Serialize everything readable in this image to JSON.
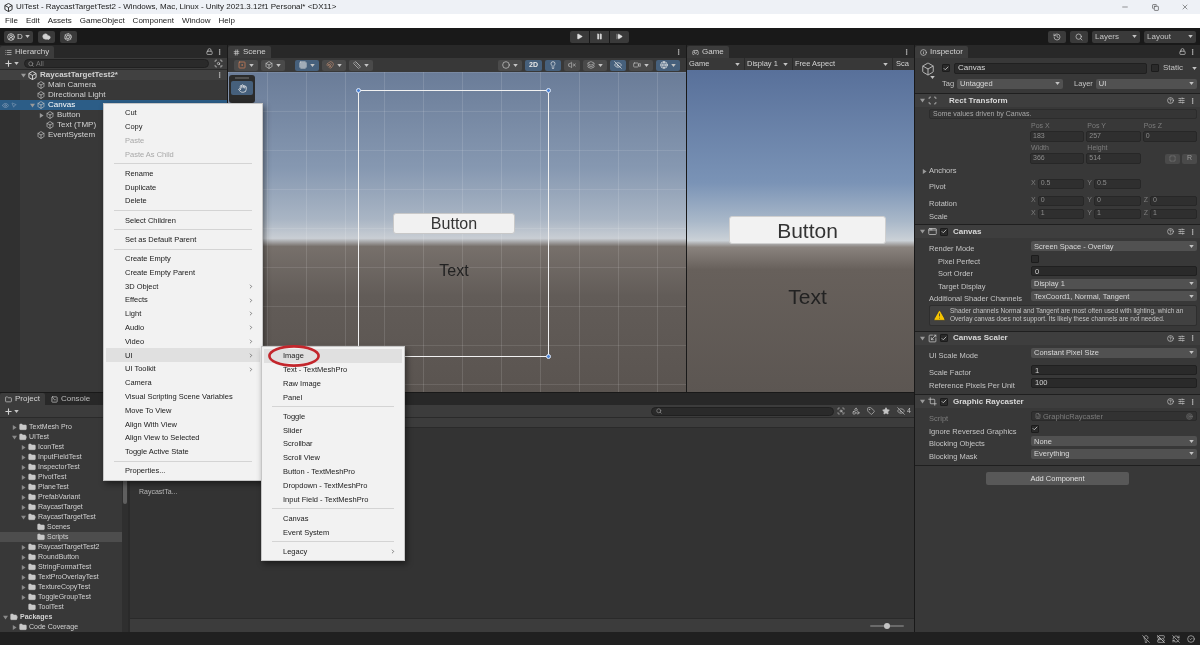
{
  "window": {
    "title": "UITest - RaycastTargetTest2 - Windows, Mac, Linux - Unity 2021.3.12f1 Personal* <DX11>"
  },
  "menu_bar": [
    "File",
    "Edit",
    "Assets",
    "GameObject",
    "Component",
    "Window",
    "Help"
  ],
  "toolbar": {
    "account": "D",
    "layers": "Layers",
    "layout": "Layout"
  },
  "hierarchy": {
    "tab": "Hierarchy",
    "search_placeholder": "All",
    "scene": {
      "label": "RaycastTargetTest2*",
      "expanded": true,
      "children": [
        {
          "label": "Main Camera",
          "selected": false
        },
        {
          "label": "Directional Light",
          "selected": false
        },
        {
          "label": "Canvas",
          "selected": true,
          "expanded": true,
          "children": [
            {
              "label": "Button",
              "selected": false,
              "expanded": false
            },
            {
              "label": "Text (TMP)",
              "selected": false
            }
          ]
        },
        {
          "label": "EventSystem",
          "selected": false
        }
      ]
    }
  },
  "scene_view": {
    "tab": "Scene",
    "toolbar_groups": [
      [
        {
          "kind": "draw_mode",
          "on": false,
          "dropdown": true
        },
        {
          "kind": "shading_cube",
          "on": false,
          "dropdown": true
        }
      ],
      [
        {
          "kind": "grid",
          "on": true,
          "dropdown": true
        },
        {
          "kind": "snap",
          "on": false,
          "dropdown": true
        },
        {
          "kind": "increment",
          "on": false,
          "dropdown": true
        }
      ],
      [
        {
          "kind": "render_sphere",
          "on": false,
          "dropdown": true
        },
        {
          "kind": "text",
          "label": "2D",
          "on": true,
          "dropdown": false
        },
        {
          "kind": "lighting",
          "on": true,
          "dropdown": false
        },
        {
          "kind": "audio",
          "on": false,
          "dropdown": false
        },
        {
          "kind": "effects",
          "on": false,
          "dropdown": true
        },
        {
          "kind": "visibility",
          "on": true,
          "dropdown": false
        },
        {
          "kind": "camera",
          "on": false,
          "dropdown": true
        },
        {
          "kind": "gizmos",
          "on": true,
          "dropdown": true
        }
      ]
    ],
    "tools": [
      {
        "kind": "hand",
        "selected": true
      }
    ],
    "button_label": "Button",
    "text_label": "Text"
  },
  "game_view": {
    "tab": "Game",
    "controls": [
      {
        "kind": "dropdown",
        "label": "Game"
      },
      {
        "kind": "dropdown",
        "label": "Display 1"
      },
      {
        "kind": "dropdown",
        "label": "Free Aspect"
      },
      {
        "kind": "label",
        "label": "Sca"
      }
    ],
    "button_label": "Button",
    "text_label": "Text"
  },
  "context_menu": {
    "groups": [
      [
        {
          "label": "Cut",
          "disabled": false,
          "submenu": false,
          "highlighted": false
        },
        {
          "label": "Copy",
          "disabled": false,
          "submenu": false,
          "highlighted": false
        },
        {
          "label": "Paste",
          "disabled": true,
          "submenu": false,
          "highlighted": false
        },
        {
          "label": "Paste As Child",
          "disabled": true,
          "submenu": false,
          "highlighted": false
        }
      ],
      [
        {
          "label": "Rename",
          "disabled": false,
          "submenu": false,
          "highlighted": false
        },
        {
          "label": "Duplicate",
          "disabled": false,
          "submenu": false,
          "highlighted": false
        },
        {
          "label": "Delete",
          "disabled": false,
          "submenu": false,
          "highlighted": false
        }
      ],
      [
        {
          "label": "Select Children",
          "disabled": false,
          "submenu": false,
          "highlighted": false
        }
      ],
      [
        {
          "label": "Set as Default Parent",
          "disabled": false,
          "submenu": false,
          "highlighted": false
        }
      ],
      [
        {
          "label": "Create Empty",
          "disabled": false,
          "submenu": false,
          "highlighted": false
        },
        {
          "label": "Create Empty Parent",
          "disabled": false,
          "submenu": false,
          "highlighted": false
        },
        {
          "label": "3D Object",
          "disabled": false,
          "submenu": true,
          "highlighted": false
        },
        {
          "label": "Effects",
          "disabled": false,
          "submenu": true,
          "highlighted": false
        },
        {
          "label": "Light",
          "disabled": false,
          "submenu": true,
          "highlighted": false
        },
        {
          "label": "Audio",
          "disabled": false,
          "submenu": true,
          "highlighted": false
        },
        {
          "label": "Video",
          "disabled": false,
          "submenu": true,
          "highlighted": false
        },
        {
          "label": "UI",
          "disabled": false,
          "submenu": true,
          "highlighted": true
        },
        {
          "label": "UI Toolkit",
          "disabled": false,
          "submenu": true,
          "highlighted": false
        },
        {
          "label": "Camera",
          "disabled": false,
          "submenu": false,
          "highlighted": false
        },
        {
          "label": "Visual Scripting Scene Variables",
          "disabled": false,
          "submenu": false,
          "highlighted": false
        },
        {
          "label": "Move To View",
          "disabled": false,
          "submenu": false,
          "highlighted": false
        },
        {
          "label": "Align With View",
          "disabled": false,
          "submenu": false,
          "highlighted": false
        },
        {
          "label": "Align View to Selected",
          "disabled": false,
          "submenu": false,
          "highlighted": false
        },
        {
          "label": "Toggle Active State",
          "disabled": false,
          "submenu": false,
          "highlighted": false
        }
      ],
      [
        {
          "label": "Properties...",
          "disabled": false,
          "submenu": false,
          "highlighted": false
        }
      ]
    ]
  },
  "ui_submenu": {
    "groups": [
      [
        {
          "label": "Image",
          "submenu": false,
          "highlighted": true,
          "circled": true
        },
        {
          "label": "Text - TextMeshPro",
          "submenu": false,
          "highlighted": false,
          "circled": false
        },
        {
          "label": "Raw Image",
          "submenu": false,
          "highlighted": false,
          "circled": false
        },
        {
          "label": "Panel",
          "submenu": false,
          "highlighted": false,
          "circled": false
        }
      ],
      [
        {
          "label": "Toggle",
          "submenu": false,
          "highlighted": false,
          "circled": false
        },
        {
          "label": "Slider",
          "submenu": false,
          "highlighted": false,
          "circled": false
        },
        {
          "label": "Scrollbar",
          "submenu": false,
          "highlighted": false,
          "circled": false
        },
        {
          "label": "Scroll View",
          "submenu": false,
          "highlighted": false,
          "circled": false
        },
        {
          "label": "Button - TextMeshPro",
          "submenu": false,
          "highlighted": false,
          "circled": false
        },
        {
          "label": "Dropdown - TextMeshPro",
          "submenu": false,
          "highlighted": false,
          "circled": false
        },
        {
          "label": "Input Field - TextMeshPro",
          "submenu": false,
          "highlighted": false,
          "circled": false
        }
      ],
      [
        {
          "label": "Canvas",
          "submenu": false,
          "highlighted": false,
          "circled": false
        },
        {
          "label": "Event System",
          "submenu": false,
          "highlighted": false,
          "circled": false
        }
      ],
      [
        {
          "label": "Legacy",
          "submenu": true,
          "highlighted": false,
          "circled": false
        }
      ]
    ]
  },
  "project": {
    "tabs": [
      {
        "label": "Project",
        "selected": true
      },
      {
        "label": "Console",
        "selected": false
      }
    ],
    "tree_top": [
      {
        "label": "TextMesh Pro",
        "expanded": false,
        "selected": false
      },
      {
        "label": "UITest",
        "expanded": true,
        "selected": false,
        "children": [
          {
            "label": "IconTest",
            "expanded": false,
            "selected": false
          },
          {
            "label": "InputFieldTest",
            "expanded": false,
            "selected": false
          },
          {
            "label": "InspectorTest",
            "expanded": false,
            "selected": false
          },
          {
            "label": "PivotTest",
            "expanded": false,
            "selected": false
          },
          {
            "label": "PlaneTest",
            "expanded": false,
            "selected": false
          },
          {
            "label": "PrefabVariant",
            "expanded": false,
            "selected": false
          },
          {
            "label": "RaycastTarget",
            "expanded": false,
            "selected": false
          },
          {
            "label": "RaycastTargetTest",
            "expanded": true,
            "selected": false,
            "children": [
              {
                "label": "Scenes",
                "selected": false
              },
              {
                "label": "Scripts",
                "selected": true
              }
            ]
          },
          {
            "label": "RaycastTargetTest2",
            "expanded": false,
            "selected": false
          },
          {
            "label": "RoundButton",
            "expanded": false,
            "selected": false
          },
          {
            "label": "StringFormatTest",
            "expanded": false,
            "selected": false
          },
          {
            "label": "TextProOverlayTest",
            "expanded": false,
            "selected": false
          },
          {
            "label": "TextureCopyTest",
            "expanded": false,
            "selected": false
          },
          {
            "label": "ToggleGroupTest",
            "expanded": false,
            "selected": false
          },
          {
            "label": "ToolTest",
            "selected": false
          }
        ]
      }
    ],
    "tree_roots": [
      {
        "label": "Packages",
        "expanded": true,
        "selected": false,
        "children": [
          {
            "label": "Code Coverage",
            "expanded": false,
            "selected": false
          }
        ]
      }
    ],
    "hidden_count": "4",
    "files": [
      {
        "label": "RaycastTa..."
      }
    ],
    "zoom_slider": {
      "level": 0.5
    }
  },
  "inspector": {
    "tab": "Inspector",
    "object": {
      "active": true,
      "name": "Canvas",
      "static": false,
      "static_label": "Static",
      "tag_label": "Tag",
      "tag": "Untagged",
      "layer_label": "Layer",
      "layer": "UI"
    },
    "components": [
      {
        "kind": "rect_transform",
        "title": "Rect Transform",
        "expanded": true,
        "note": "Some values driven by Canvas.",
        "position": [
          {
            "label": "Pos X",
            "value": "183",
            "disabled": true
          },
          {
            "label": "Pos Y",
            "value": "257",
            "disabled": true
          },
          {
            "label": "Pos Z",
            "value": "0",
            "disabled": true
          }
        ],
        "size": [
          {
            "label": "Width",
            "value": "366",
            "disabled": true
          },
          {
            "label": "Height",
            "value": "514",
            "disabled": true
          }
        ],
        "raw_button": "R",
        "anchors": {
          "label": "Anchors",
          "expanded": false
        },
        "groups": [
          [
            {
              "label": "Pivot",
              "axes": [
                {
                  "axis": "X",
                  "value": "0.5",
                  "disabled": true
                },
                {
                  "axis": "Y",
                  "value": "0.5",
                  "disabled": true
                }
              ]
            }
          ],
          [
            {
              "label": "Rotation",
              "axes": [
                {
                  "axis": "X",
                  "value": "0",
                  "disabled": true
                },
                {
                  "axis": "Y",
                  "value": "0",
                  "disabled": true
                },
                {
                  "axis": "Z",
                  "value": "0",
                  "disabled": true
                }
              ]
            },
            {
              "label": "Scale",
              "axes": [
                {
                  "axis": "X",
                  "value": "1",
                  "disabled": true
                },
                {
                  "axis": "Y",
                  "value": "1",
                  "disabled": true
                },
                {
                  "axis": "Z",
                  "value": "1",
                  "disabled": true
                }
              ]
            }
          ]
        ]
      },
      {
        "kind": "canvas",
        "title": "Canvas",
        "enabled": true,
        "expanded": true,
        "groups": [
          [
            {
              "kind": "dropdown",
              "label": "Render Mode",
              "value": "Screen Space - Overlay",
              "children": [
                {
                  "kind": "checkbox",
                  "label": "Pixel Perfect",
                  "checked": false
                },
                {
                  "kind": "number",
                  "label": "Sort Order",
                  "value": "0"
                },
                {
                  "kind": "dropdown",
                  "label": "Target Display",
                  "value": "Display 1"
                }
              ]
            },
            {
              "kind": "dropdown",
              "label": "Additional Shader Channels",
              "value": "TexCoord1, Normal, Tangent"
            },
            {
              "kind": "warning",
              "text": "Shader channels Normal and Tangent are most often used with lighting, which an Overlay canvas does not support. Its likely these channels are not needed."
            }
          ]
        ]
      },
      {
        "kind": "canvas_scaler",
        "title": "Canvas Scaler",
        "enabled": true,
        "expanded": true,
        "groups": [
          [
            {
              "kind": "dropdown",
              "label": "UI Scale Mode",
              "value": "Constant Pixel Size"
            }
          ],
          [
            {
              "kind": "number",
              "label": "Scale Factor",
              "value": "1"
            },
            {
              "kind": "number",
              "label": "Reference Pixels Per Unit",
              "value": "100"
            }
          ]
        ]
      },
      {
        "kind": "graphic_raycaster",
        "title": "Graphic Raycaster",
        "enabled": true,
        "expanded": true,
        "groups": [
          [
            {
              "kind": "script",
              "label": "Script",
              "value": "GraphicRaycaster",
              "disabled": true
            },
            {
              "kind": "checkbox",
              "label": "Ignore Reversed Graphics",
              "checked": true
            },
            {
              "kind": "dropdown",
              "label": "Blocking Objects",
              "value": "None"
            },
            {
              "kind": "dropdown",
              "label": "Blocking Mask",
              "value": "Everything"
            }
          ]
        ]
      }
    ],
    "add_component": "Add Component"
  }
}
